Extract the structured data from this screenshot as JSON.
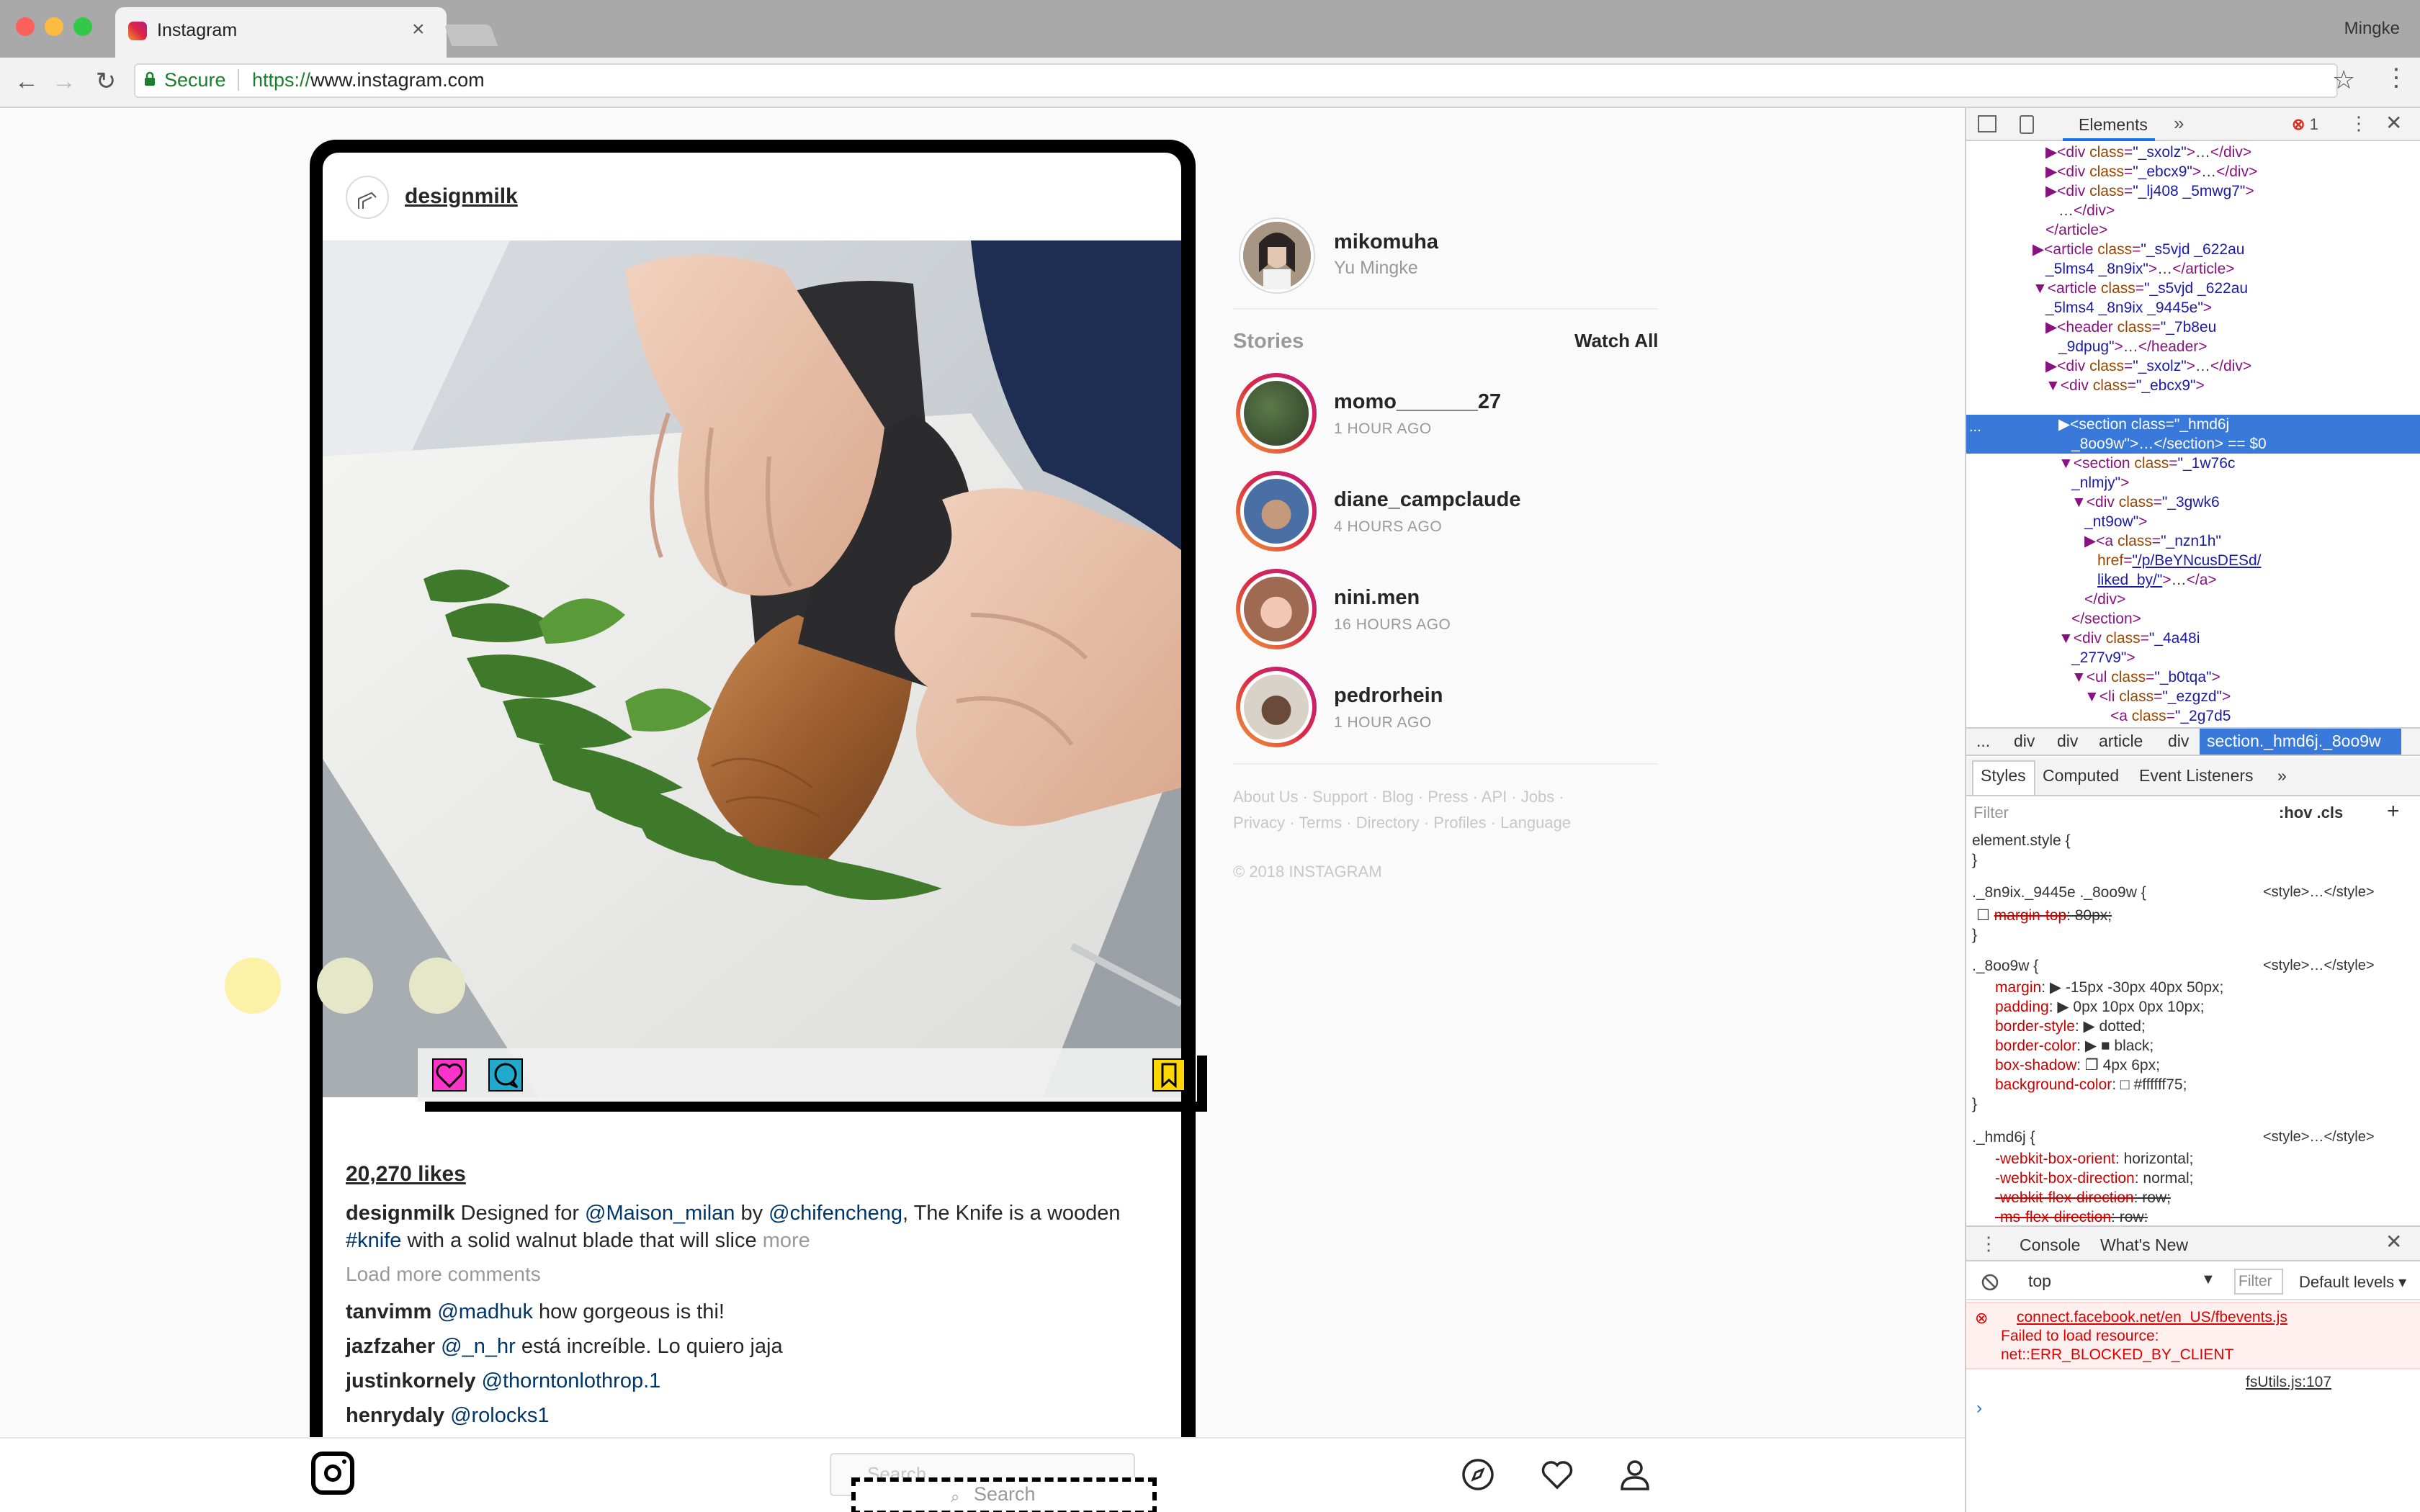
{
  "browser": {
    "tab_title": "Instagram",
    "tab_close": "×",
    "profile_name": "Mingke",
    "secure_label": "Secure",
    "url_scheme": "https://",
    "url_host": "www.instagram.com",
    "back": "←",
    "forward": "→",
    "reload": "↻",
    "bookmark": "☆",
    "menu": "⋮"
  },
  "post": {
    "username": "designmilk",
    "likes": "20,270 likes",
    "caption": {
      "author": "designmilk",
      "t1": " Designed for ",
      "m1": "@Maison_milan",
      "t2": " by ",
      "m2": "@chifencheng",
      "t3": ", The Knife is a wooden",
      "h1": "#knife",
      "t4": " with a solid walnut blade that will slice ",
      "more": "more"
    },
    "load_more": "Load more comments",
    "comments": [
      {
        "user": "tanvimm",
        "mention": "@madhuk",
        "text": " how gorgeous is thi!"
      },
      {
        "user": "jazfzaher",
        "mention": "@_n_hr",
        "text": " está increíble. Lo quiero jaja"
      },
      {
        "user": "justinkornely",
        "mention": "@thorntonlothrop.1",
        "text": ""
      },
      {
        "user": "henrydaly",
        "mention": "@rolocks1",
        "text": ""
      }
    ]
  },
  "sidebar": {
    "me": {
      "username": "mikomuha",
      "fullname": "Yu Mingke"
    },
    "stories_heading": "Stories",
    "watch_all": "Watch All",
    "stories": [
      {
        "name": "momo_______27",
        "time": "1 HOUR AGO"
      },
      {
        "name": "diane_campclaude",
        "time": "4 HOURS AGO"
      },
      {
        "name": "nini.men",
        "time": "16 HOURS AGO"
      },
      {
        "name": "pedrorhein",
        "time": "1 HOUR AGO"
      }
    ],
    "footer_line1": "About Us · Support · Blog · Press · API · Jobs ·",
    "footer_line2": "Privacy · Terms · Directory · Profiles · Language",
    "copyright": "© 2018 INSTAGRAM"
  },
  "bottom_nav": {
    "search_placeholder": "Search",
    "search_label": "Search",
    "search_icon": "⌕"
  },
  "devtools": {
    "tab_elements": "Elements",
    "more": "»",
    "error_icon": "⊗",
    "error_count": "1",
    "kebab": "⋮",
    "close": "✕",
    "selected_dots": "...",
    "dom_lines": [
      [
        "",
        "div",
        "_sxolz",
        "…</div>"
      ],
      [
        "",
        "div",
        "_ebcx9",
        "…</div>"
      ],
      [
        "",
        "div",
        "_lj408 _5mwg7",
        ""
      ]
    ],
    "breadcrumbs": [
      "...",
      "div",
      "div",
      "article",
      "div"
    ],
    "breadcrumb_active": "section._hmd6j._8oo9w",
    "styles_tabs": [
      "Styles",
      "Computed",
      "Event Listeners",
      "»"
    ],
    "styles_filter": "Filter",
    "hov_cls": ":hov  .cls",
    "plus": "+",
    "console_tab": "Console",
    "whats_new": "What's New",
    "context": "top",
    "filter_placeholder": "Filter",
    "levels": "Default levels ▾",
    "error_url": "connect.facebook.net/en_US/fbevents.js",
    "error_msg1": "Failed to load resource:",
    "error_msg2": "net::ERR_BLOCKED_BY_CLIENT",
    "error_source": "fsUtils.js:107",
    "prompt": "›"
  },
  "colors": {
    "like": "#ff33cc",
    "comment": "#22aacc",
    "save": "#ffd700",
    "selection": "#3879d9",
    "link": "#003569"
  }
}
